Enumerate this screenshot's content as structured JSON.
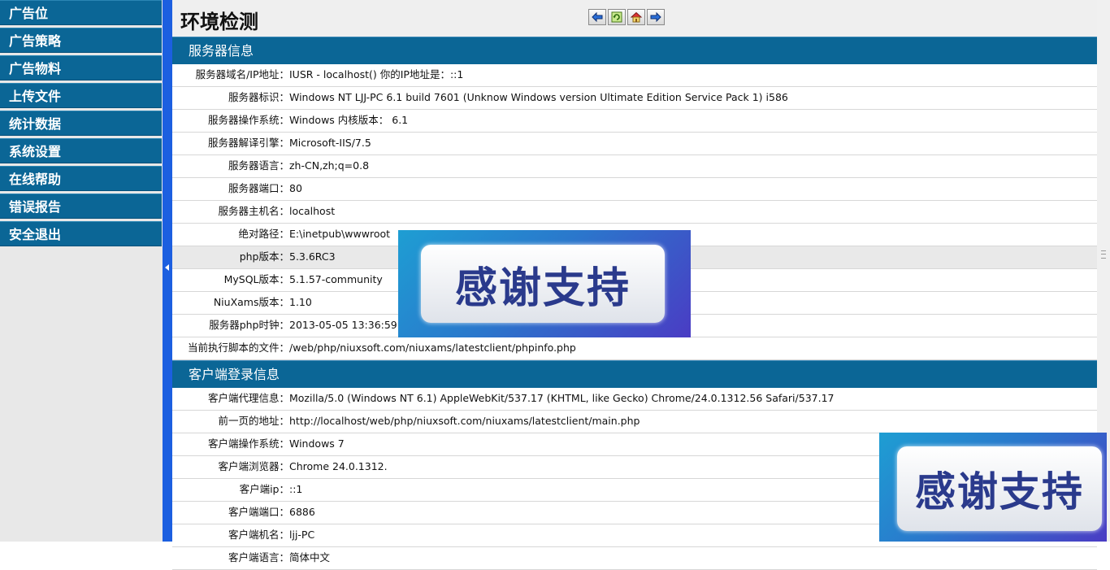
{
  "sidebar": {
    "items": [
      {
        "label": "广告位"
      },
      {
        "label": "广告策略"
      },
      {
        "label": "广告物料"
      },
      {
        "label": "上传文件"
      },
      {
        "label": "统计数据"
      },
      {
        "label": "系统设置"
      },
      {
        "label": "在线帮助"
      },
      {
        "label": "错误报告"
      },
      {
        "label": "安全退出"
      }
    ]
  },
  "header": {
    "title": "环境检测",
    "nav_icons": [
      "back-arrow-icon",
      "refresh-icon",
      "home-icon",
      "forward-arrow-icon"
    ]
  },
  "server_section": {
    "title": "服务器信息",
    "rows": [
      {
        "label": "服务器域名/IP地址：",
        "value": "IUSR - localhost()  你的IP地址是：::1"
      },
      {
        "label": "服务器标识：",
        "value": "Windows NT LJJ-PC 6.1 build 7601 (Unknow Windows version Ultimate Edition Service Pack 1) i586"
      },
      {
        "label": "服务器操作系统：",
        "value": "Windows  内核版本： 6.1"
      },
      {
        "label": "服务器解译引擎：",
        "value": "Microsoft-IIS/7.5"
      },
      {
        "label": "服务器语言：",
        "value": "zh-CN,zh;q=0.8"
      },
      {
        "label": "服务器端口：",
        "value": "80"
      },
      {
        "label": "服务器主机名：",
        "value": "localhost"
      },
      {
        "label": "绝对路径：",
        "value": "E:\\inetpub\\wwwroot"
      },
      {
        "label": "php版本：",
        "value": "5.3.6RC3"
      },
      {
        "label": "MySQL版本：",
        "value": "5.1.57-community"
      },
      {
        "label": "NiuXams版本：",
        "value": "1.10"
      },
      {
        "label": "服务器php时钟：",
        "value": "2013-05-05 13:36:59"
      },
      {
        "label": "当前执行脚本的文件：",
        "value": "/web/php/niuxsoft.com/niuxams/latestclient/phpinfo.php"
      }
    ]
  },
  "client_section": {
    "title": "客户端登录信息",
    "rows": [
      {
        "label": "客户端代理信息：",
        "value": "Mozilla/5.0 (Windows NT 6.1) AppleWebKit/537.17 (KHTML, like Gecko) Chrome/24.0.1312.56 Safari/537.17"
      },
      {
        "label": "前一页的地址：",
        "value": "http://localhost/web/php/niuxsoft.com/niuxams/latestclient/main.php"
      },
      {
        "label": "客户端操作系统：",
        "value": "Windows 7"
      },
      {
        "label": "客户端浏览器：",
        "value": "Chrome 24.0.1312."
      },
      {
        "label": "客户端ip：",
        "value": "::1"
      },
      {
        "label": "客户端端口：",
        "value": "6886"
      },
      {
        "label": "客户端机名：",
        "value": "ljj-PC"
      },
      {
        "label": "客户端语言：",
        "value": "简体中文"
      }
    ]
  },
  "watermark": {
    "text": "感谢支持"
  },
  "colors": {
    "accent": "#0b6696",
    "splitter": "#1c5fe0",
    "highlight_row": "#e9e9e9"
  }
}
